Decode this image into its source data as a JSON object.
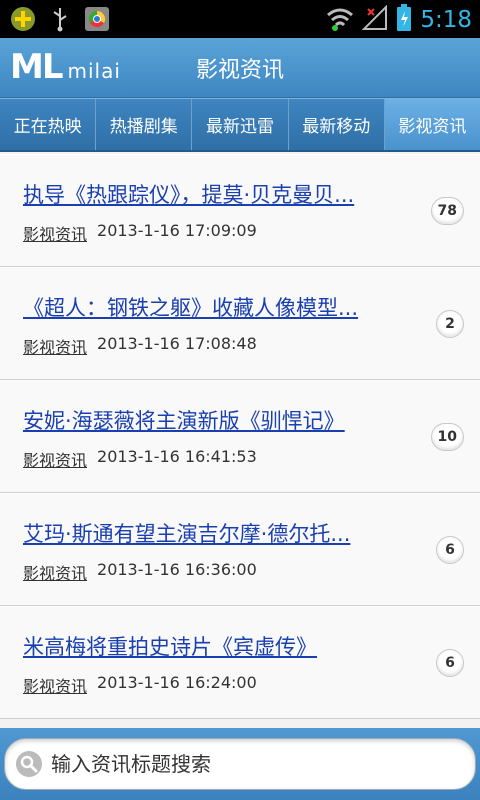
{
  "status": {
    "time": "5:18"
  },
  "app": {
    "logo_main": "ML",
    "logo_sub": "milai",
    "title": "影视资讯"
  },
  "tabs": [
    {
      "label": "正在热映"
    },
    {
      "label": "热播剧集"
    },
    {
      "label": "最新迅雷"
    },
    {
      "label": "最新移动"
    },
    {
      "label": "影视资讯",
      "active": true
    }
  ],
  "news": [
    {
      "title": "执导《热跟踪仪》，提莫·贝克曼贝...",
      "category": "影视资讯",
      "time": "2013-1-16 17:09:09",
      "count": "78"
    },
    {
      "title": "《超人：钢铁之躯》收藏人像模型...",
      "category": "影视资讯",
      "time": "2013-1-16 17:08:48",
      "count": "2"
    },
    {
      "title": "安妮·海瑟薇将主演新版《驯悍记》",
      "category": "影视资讯",
      "time": "2013-1-16 16:41:53",
      "count": "10"
    },
    {
      "title": "艾玛·斯通有望主演吉尔摩·德尔托...",
      "category": "影视资讯",
      "time": "2013-1-16 16:36:00",
      "count": "6"
    },
    {
      "title": "米高梅将重拍史诗片《宾虚传》",
      "category": "影视资讯",
      "time": "2013-1-16 16:24:00",
      "count": "6"
    }
  ],
  "search": {
    "placeholder": "输入资讯标题搜索"
  },
  "colors": {
    "accent": "#3d86c2",
    "link": "#1a3fb0",
    "clock": "#33b5e5"
  }
}
